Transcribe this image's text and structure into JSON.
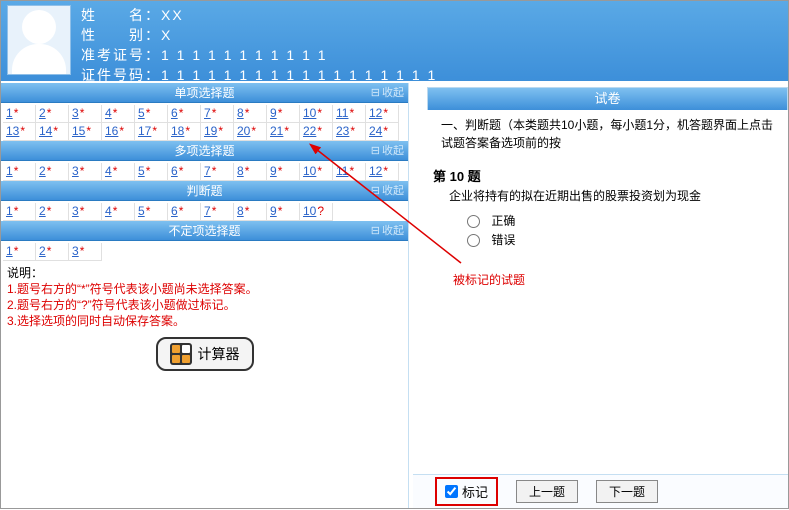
{
  "header": {
    "name_label": "姓　　名：",
    "name_value": "XX",
    "gender_label": "性　　别：",
    "gender_value": "X",
    "ticket_label": "准考证号：",
    "ticket_value": "1 1 1 1 1 1 1 1 1 1 1",
    "id_label": "证件号码：",
    "id_value": "1 1 1 1 1 1 1 1 1 1 1 1 1 1 1 1 1 1"
  },
  "sections": {
    "collapse_label": "收起",
    "single": {
      "title": "单项选择题",
      "items": [
        {
          "n": "1",
          "m": "*"
        },
        {
          "n": "2",
          "m": "*"
        },
        {
          "n": "3",
          "m": "*"
        },
        {
          "n": "4",
          "m": "*"
        },
        {
          "n": "5",
          "m": "*"
        },
        {
          "n": "6",
          "m": "*"
        },
        {
          "n": "7",
          "m": "*"
        },
        {
          "n": "8",
          "m": "*"
        },
        {
          "n": "9",
          "m": "*"
        },
        {
          "n": "10",
          "m": "*"
        },
        {
          "n": "11",
          "m": "*"
        },
        {
          "n": "12",
          "m": "*"
        },
        {
          "n": "13",
          "m": "*"
        },
        {
          "n": "14",
          "m": "*"
        },
        {
          "n": "15",
          "m": "*"
        },
        {
          "n": "16",
          "m": "*"
        },
        {
          "n": "17",
          "m": "*"
        },
        {
          "n": "18",
          "m": "*"
        },
        {
          "n": "19",
          "m": "*"
        },
        {
          "n": "20",
          "m": "*"
        },
        {
          "n": "21",
          "m": "*"
        },
        {
          "n": "22",
          "m": "*"
        },
        {
          "n": "23",
          "m": "*"
        },
        {
          "n": "24",
          "m": "*"
        }
      ]
    },
    "multi": {
      "title": "多项选择题",
      "items": [
        {
          "n": "1",
          "m": "*"
        },
        {
          "n": "2",
          "m": "*"
        },
        {
          "n": "3",
          "m": "*"
        },
        {
          "n": "4",
          "m": "*"
        },
        {
          "n": "5",
          "m": "*"
        },
        {
          "n": "6",
          "m": "*"
        },
        {
          "n": "7",
          "m": "*"
        },
        {
          "n": "8",
          "m": "*"
        },
        {
          "n": "9",
          "m": "*"
        },
        {
          "n": "10",
          "m": "*"
        },
        {
          "n": "11",
          "m": "*"
        },
        {
          "n": "12",
          "m": "*"
        }
      ]
    },
    "judge": {
      "title": "判断题",
      "items": [
        {
          "n": "1",
          "m": "*"
        },
        {
          "n": "2",
          "m": "*"
        },
        {
          "n": "3",
          "m": "*"
        },
        {
          "n": "4",
          "m": "*"
        },
        {
          "n": "5",
          "m": "*"
        },
        {
          "n": "6",
          "m": "*"
        },
        {
          "n": "7",
          "m": "*"
        },
        {
          "n": "8",
          "m": "*"
        },
        {
          "n": "9",
          "m": "*"
        },
        {
          "n": "10",
          "m": "?"
        }
      ]
    },
    "uncertain": {
      "title": "不定项选择题",
      "items": [
        {
          "n": "1",
          "m": "*"
        },
        {
          "n": "2",
          "m": "*"
        },
        {
          "n": "3",
          "m": "*"
        }
      ]
    }
  },
  "notes": {
    "title": "说明：",
    "line1": "1.题号右方的“*”符号代表该小题尚未选择答案。",
    "line2": "2.题号右方的“?”符号代表该小题做过标记。",
    "line3": "3.选择选项的同时自动保存答案。"
  },
  "calc_label": "计算器",
  "right": {
    "tab_label": "试卷",
    "instr": "一、判断题（本类题共10小题，每小题1分，机答题界面上点击试题答案备选项前的按",
    "q_no": "第 10 题",
    "stem": "企业将持有的拟在近期出售的股票投资划为现金",
    "opt_true": "正确",
    "opt_false": "错误"
  },
  "annotation": {
    "marked_text": "被标记的试题"
  },
  "bottom": {
    "mark_label": "标记",
    "prev": "上一题",
    "next": "下一题"
  }
}
